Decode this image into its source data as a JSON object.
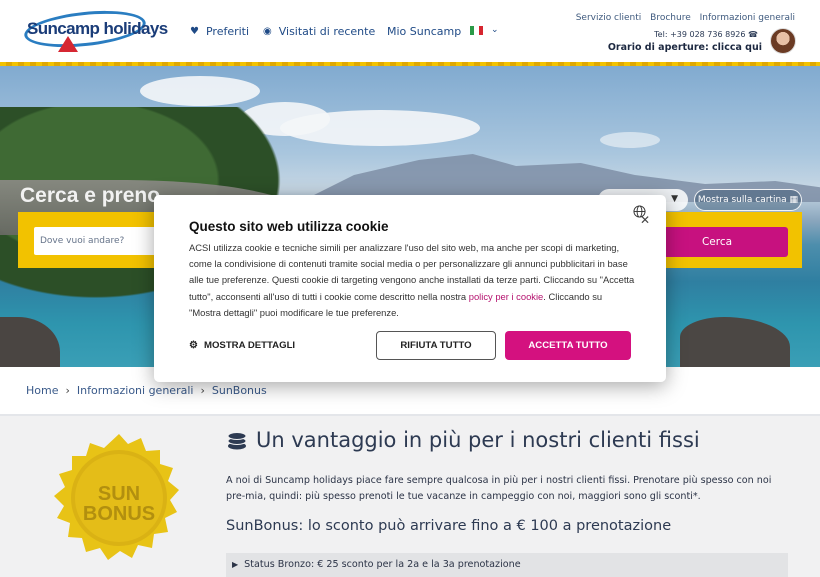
{
  "header": {
    "logo_text": "Suncamp holidays",
    "nav": [
      {
        "icon": "heart-icon",
        "label": "Preferiti"
      },
      {
        "icon": "eye-icon",
        "label": "Visitati di recente"
      },
      {
        "label": "Mio Suncamp"
      }
    ],
    "language_flag": "italian-flag",
    "top_links": [
      "Servizio clienti",
      "Brochure",
      "Informazioni generali"
    ],
    "phone": "Tel: +39 028 736 8926",
    "opening_hours": "Orario di aperture: clicca qui"
  },
  "hero": {
    "title": "Cerca e preno",
    "search_placeholder": "Dove vuoi andare?",
    "search_button": "Cerca",
    "map_button": "Mostra sulla cartina"
  },
  "cookie_modal": {
    "title": "Questo sito web utilizza cookie",
    "body_before_link": "ACSI utilizza cookie e tecniche simili per analizzare l'uso del sito web, ma anche per scopi di marketing, come la condivisione di contenuti tramite social media o per personalizzare gli annunci pubblicitari in base alle tue preferenze. Questi cookie di targeting vengono anche installati da terze parti. Cliccando su \"Accetta tutto\", acconsenti all'uso di tutti i cookie come descritto nella nostra ",
    "link_text": "policy per i cookie",
    "body_after_link": ". Cliccando su \"Mostra dettagli\" puoi modificare le tue preferenze.",
    "details_button": "MOSTRA DETTAGLI",
    "reject_button": "RIFIUTA TUTTO",
    "accept_button": "ACCETTA TUTTO",
    "accent_color": "#d4117f"
  },
  "breadcrumb": [
    "Home",
    "Informazioni generali",
    "SunBonus"
  ],
  "main": {
    "badge_line1": "SUN",
    "badge_line2": "BONUS",
    "title": "Un vantaggio in più per i nostri clienti fissi",
    "intro": "A noi di Suncamp holidays piace fare sempre qualcosa in più per i nostri clienti fissi. Prenotare più spesso con noi pre-mia, quindi: più spesso prenoti le tue vacanze in campeggio con noi, maggiori sono gli sconti*.",
    "subheading": "SunBonus: lo sconto può arrivare fino a € 100 a prenotazione",
    "status_rows": [
      "Status Bronzo: € 25 sconto per la 2a e la 3a prenotazione"
    ]
  }
}
